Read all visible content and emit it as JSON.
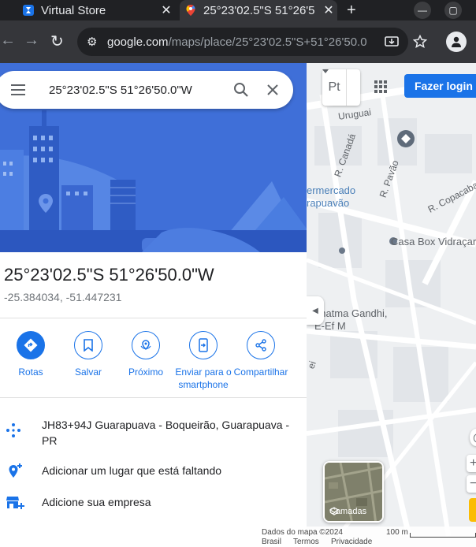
{
  "browser": {
    "tabs": [
      {
        "title": "Virtual Store",
        "active": false,
        "icon": "virtual-store-favicon"
      },
      {
        "title": "25°23'02.5\"S 51°26'5",
        "active": true,
        "icon": "google-maps-pin-favicon"
      }
    ],
    "url": {
      "domain": "google.com",
      "path": "/maps/place/25°23'02.5\"S+51°26'50.0\"..."
    }
  },
  "search": {
    "query": "25°23'02.5\"S 51°26'50.0\"W"
  },
  "place": {
    "title": "25°23'02.5\"S 51°26'50.0\"W",
    "decimal": "-25.384034, -51.447231"
  },
  "actions": [
    {
      "label": "Rotas",
      "icon": "directions-icon"
    },
    {
      "label": "Salvar",
      "icon": "bookmark-icon"
    },
    {
      "label": "Próximo",
      "icon": "nearby-icon"
    },
    {
      "label": "Enviar para o smartphone",
      "icon": "send-to-phone-icon"
    },
    {
      "label": "Compartilhar",
      "icon": "share-icon"
    }
  ],
  "info": [
    {
      "text": "JH83+94J Guarapuava - Boqueirão, Guarapuava - PR",
      "icon": "plus-code-icon"
    },
    {
      "text": "Adicionar um lugar que está faltando",
      "icon": "add-place-icon"
    },
    {
      "text": "Adicione sua empresa",
      "icon": "add-business-icon"
    }
  ],
  "map": {
    "login_label": "Fazer login",
    "layer_toggle_label": "Pt",
    "layers_label": "Camadas",
    "labels": {
      "street_uruguai": "Uruguai",
      "street_canada": "R. Canadá",
      "street_pavao": "R. Pavão",
      "street_copacabana": "R. Copacabana",
      "supermercado_1": "ermercado",
      "supermercado_2": "rapuavão",
      "casa_box": "Casa Box Vidraçaria",
      "mahatma": "ahatma Gandhi,",
      "ef_m": "E-Ef M",
      "partial": "ei"
    },
    "attribution": {
      "data": "Dados do mapa ©2024",
      "scale": "100 m",
      "brasil": "Brasil",
      "termos": "Termos",
      "privacidade": "Privacidade"
    }
  },
  "colors": {
    "accent": "#1a73e8",
    "hero_bg": "#3f6fd8",
    "chrome_dark": "#202124",
    "chrome_toolbar": "#35363a"
  }
}
